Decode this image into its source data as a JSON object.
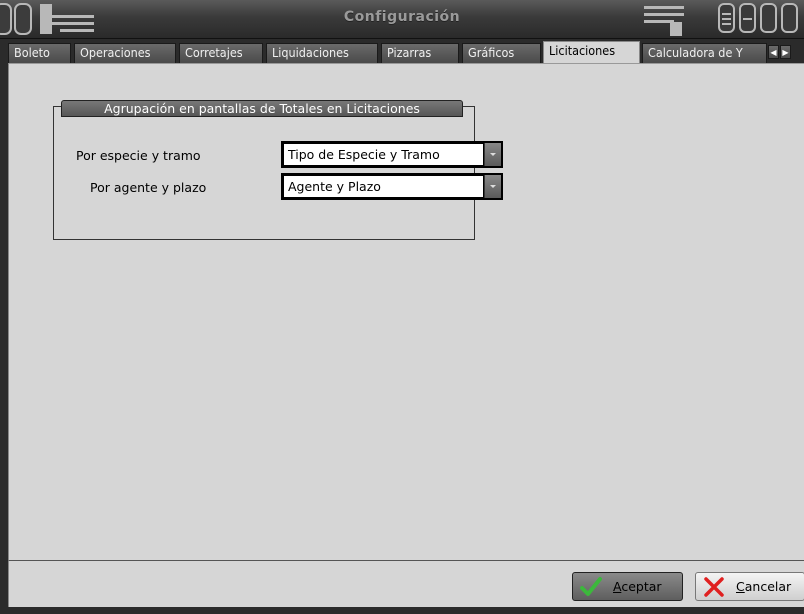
{
  "window": {
    "title": "Configuración"
  },
  "tabs": [
    {
      "label": "Boleto",
      "active": false
    },
    {
      "label": "Operaciones",
      "active": false
    },
    {
      "label": "Corretajes",
      "active": false
    },
    {
      "label": "Liquidaciones",
      "active": false
    },
    {
      "label": "Pizarras",
      "active": false
    },
    {
      "label": "Gráficos",
      "active": false
    },
    {
      "label": "Licitaciones",
      "active": true
    },
    {
      "label": "Calculadora de Y",
      "active": false
    }
  ],
  "group": {
    "title": "Agrupación en pantallas de Totales en Licitaciones",
    "rows": [
      {
        "label": "Por especie y tramo",
        "value": "Tipo de Especie y Tramo"
      },
      {
        "label": "Por agente y plazo",
        "value": "Agente y Plazo"
      }
    ]
  },
  "buttons": {
    "accept": {
      "mnemonic": "A",
      "rest": "ceptar"
    },
    "cancel": {
      "mnemonic": "C",
      "rest": "ancelar"
    }
  },
  "colors": {
    "chrome": "#2b2b2b",
    "panel": "#d6d6d6",
    "accent_check": "#3cb83c",
    "cancel_x": "#e02020"
  },
  "icons": {
    "accept": "checkmark-icon",
    "cancel": "x-icon",
    "tab_scroll_left": "left-triangle-icon",
    "tab_scroll_right": "right-triangle-icon",
    "dropdown": "chevron-down-icon"
  }
}
